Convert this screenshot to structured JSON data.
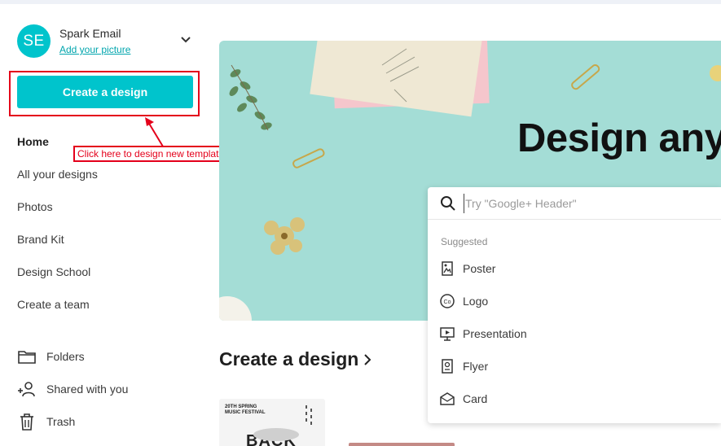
{
  "account": {
    "initials": "SE",
    "name": "Spark Email",
    "add_picture_link": "Add your picture"
  },
  "create_button": {
    "label": "Create a design"
  },
  "annotation": {
    "text": "Click here to design new template."
  },
  "nav": {
    "items": [
      {
        "label": "Home",
        "active": true
      },
      {
        "label": "All your designs"
      },
      {
        "label": "Photos"
      },
      {
        "label": "Brand Kit"
      },
      {
        "label": "Design School"
      },
      {
        "label": "Create a team"
      }
    ],
    "icon_items": [
      {
        "label": "Folders",
        "icon": "folder-icon"
      },
      {
        "label": "Shared with you",
        "icon": "people-icon"
      },
      {
        "label": "Trash",
        "icon": "trash-icon"
      }
    ]
  },
  "hero": {
    "title": "Design any"
  },
  "search": {
    "placeholder": "Try \"Google+ Header\"",
    "suggested_label": "Suggested",
    "suggestions": [
      {
        "label": "Poster",
        "icon": "poster-icon"
      },
      {
        "label": "Logo",
        "icon": "logo-icon"
      },
      {
        "label": "Presentation",
        "icon": "presentation-icon"
      },
      {
        "label": "Flyer",
        "icon": "flyer-icon"
      },
      {
        "label": "Card",
        "icon": "card-icon"
      }
    ]
  },
  "section": {
    "title": "Create a design"
  },
  "thumbnail": {
    "line1": "20TH SPRING",
    "line2": "MUSIC FESTIVAL",
    "big": "BACK"
  },
  "colors": {
    "accent": "#00c4cc",
    "annotation": "#e4001b",
    "hero_bg": "#a4ddd6"
  }
}
